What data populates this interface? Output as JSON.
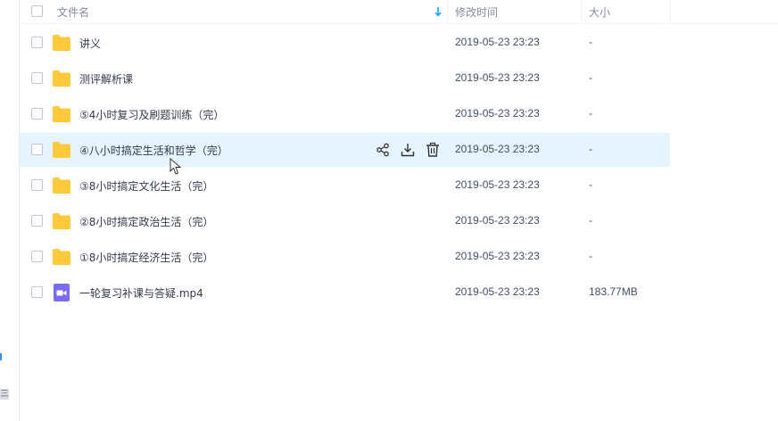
{
  "header": {
    "name_label": "文件名",
    "time_label": "修改时间",
    "size_label": "大小",
    "sort_icon": "sort-down-arrow-icon",
    "accent": "#06a7ff"
  },
  "rows": [
    {
      "name": "讲义",
      "time": "2019-05-23 23:23",
      "size": "-",
      "type": "folder"
    },
    {
      "name": "测评解析课",
      "time": "2019-05-23 23:23",
      "size": "-",
      "type": "folder"
    },
    {
      "name": "⑤4小时复习及刷题训练（完）",
      "time": "2019-05-23 23:23",
      "size": "-",
      "type": "folder"
    },
    {
      "name": "④八小时搞定生活和哲学（完）",
      "time": "2019-05-23 23:23",
      "size": "-",
      "type": "folder",
      "hovered": true
    },
    {
      "name": "③8小时搞定文化生活（完）",
      "time": "2019-05-23 23:23",
      "size": "-",
      "type": "folder"
    },
    {
      "name": "②8小时搞定政治生活（完）",
      "time": "2019-05-23 23:23",
      "size": "-",
      "type": "folder"
    },
    {
      "name": "①8小时搞定经济生活（完）",
      "time": "2019-05-23 23:23",
      "size": "-",
      "type": "folder"
    },
    {
      "name": "一轮复习补课与答疑.mp4",
      "time": "2019-05-23 23:23",
      "size": "183.77MB",
      "type": "video"
    }
  ],
  "row_actions": [
    "share-icon",
    "download-icon",
    "delete-icon"
  ],
  "colors": {
    "folder": "#ffc93d",
    "video": "#7a6cf0",
    "hover_row": "#e6f4fd"
  }
}
